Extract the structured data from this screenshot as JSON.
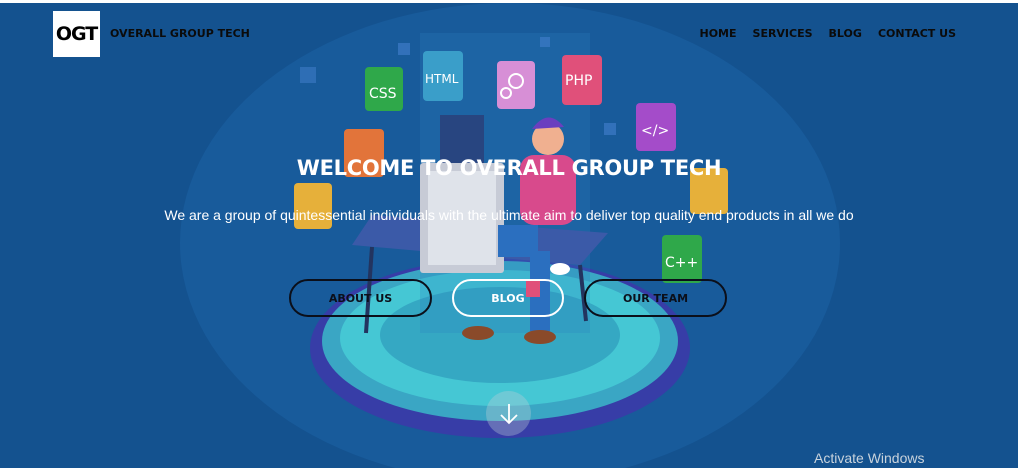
{
  "nav": {
    "logo_text": "OGT",
    "brand": "OVERALL GROUP TECH",
    "menu": [
      "HOME",
      "SERVICES",
      "BLOG",
      "CONTACT US"
    ]
  },
  "hero": {
    "title": "WELCOME TO OVERALL GROUP TECH",
    "subtitle": "We are a group of quintessential individuals with the ultimate aim to deliver top quality end products in all we do",
    "buttons": {
      "about": "ABOUT US",
      "blog": "BLOG",
      "team": "OUR TEAM"
    },
    "tiles": [
      "CSS",
      "HTML",
      "PHP",
      "</>",
      "C++"
    ],
    "scroll_icon": "arrow-down-icon"
  },
  "watermark": "Activate Windows",
  "colors": {
    "hero_bg": "#14528f",
    "platform": "#2fb8c8",
    "shirt": "#d84a8c"
  }
}
